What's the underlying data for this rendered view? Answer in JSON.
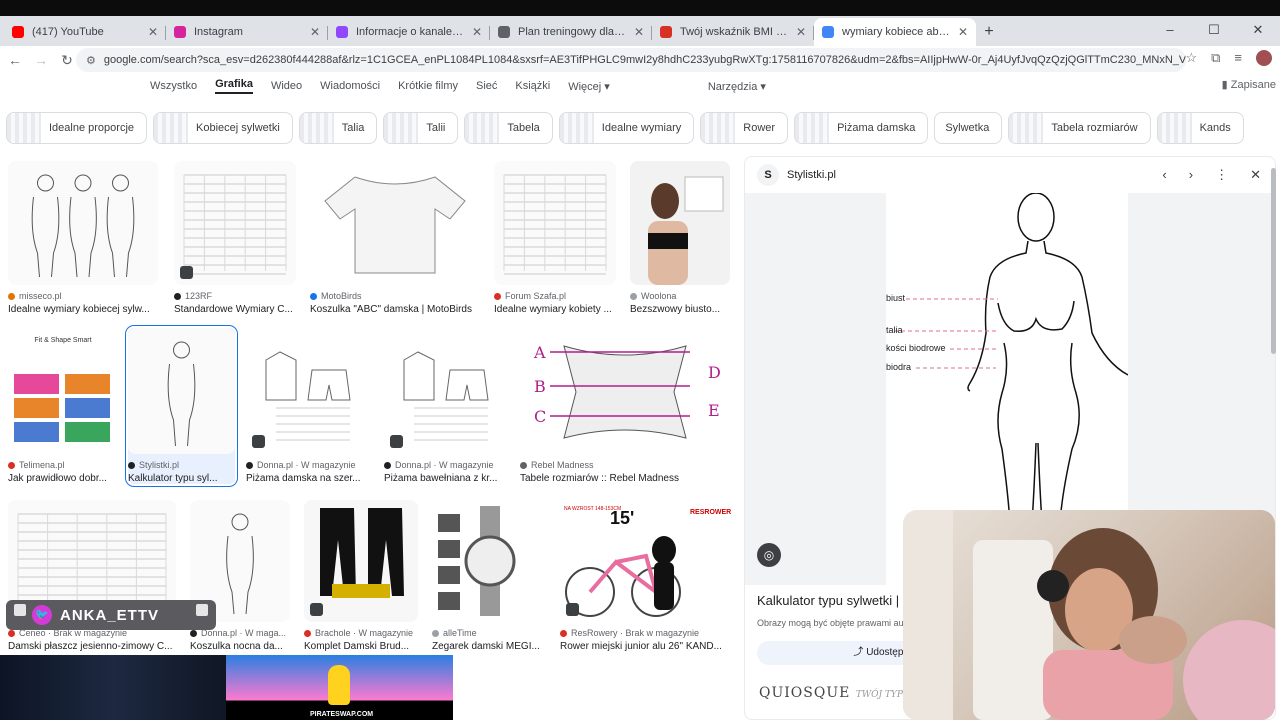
{
  "browser": {
    "tabs": [
      {
        "title": "(417) YouTube",
        "color": "#ff0000",
        "active": false
      },
      {
        "title": "Instagram",
        "color": "#d6249f",
        "active": false
      },
      {
        "title": "Informacje o kanale anka_e - Tw",
        "color": "#9146ff",
        "active": false
      },
      {
        "title": "Plan treningowy dla kobiety",
        "color": "#5f6368",
        "active": false
      },
      {
        "title": "Twój wskaźnik BMI - Diety NFZ",
        "color": "#d93025",
        "active": false
      },
      {
        "title": "wymiary kobiece abc - Szukaj w",
        "color": "#4285f4",
        "active": true
      }
    ],
    "new_tab": "+",
    "url": "google.com/search?sca_esv=d262380f444288af&rlz=1C1GCEA_enPL1084PL1084&sxsrf=AE3TifPHGLC9mwI2y8hdhC233yubgRwXTg:1758116707826&udm=2&fbs=AIIjpHwW-0r_Aj4UyfJvqQzQzjQGlTTmC230_MNxN_VvYo5ocBioNjs2eU9dWE6kP5lXYjf..."
  },
  "search_nav": {
    "tabs": [
      "Wszystko",
      "Grafika",
      "Wideo",
      "Wiadomości",
      "Krótkie filmy",
      "Sieć",
      "Książki",
      "Więcej ▾"
    ],
    "active": "Grafika",
    "tools": "Narzędzia ▾",
    "saved": "Zapisane"
  },
  "chips": [
    "Idealne proporcje",
    "Kobiecej sylwetki",
    "Talia",
    "Talii",
    "Tabela",
    "Idealne wymiary",
    "Rower",
    "Piżama damska",
    "Sylwetka",
    "Tabela rozmiarów",
    "Kands"
  ],
  "results": [
    {
      "source": "misseco.pl",
      "title": "Idealne wymiary kobiecej sylw...",
      "color": "#e37400"
    },
    {
      "source": "123RF",
      "title": "Standardowe Wymiary C...",
      "color": "#202124"
    },
    {
      "source": "MotoBirds",
      "title": "Koszulka \"ABC\" damska | MotoBirds",
      "color": "#1a73e8"
    },
    {
      "source": "Forum Szafa.pl",
      "title": "Idealne wymiary kobiety ...",
      "color": "#d93025"
    },
    {
      "source": "Woolona",
      "title": "Bezszwowy biusto...",
      "color": "#9aa0a6"
    },
    {
      "source": "Telimena.pl",
      "title": "Jak prawidłowo dobr...",
      "color": "#d93025"
    },
    {
      "source": "Stylistki.pl",
      "title": "Kalkulator typu syl...",
      "color": "#202124"
    },
    {
      "source": "Donna.pl · W magazynie",
      "title": "Piżama damska na szer...",
      "color": "#202124"
    },
    {
      "source": "Donna.pl · W magazynie",
      "title": "Piżama bawełniana z kr...",
      "color": "#202124"
    },
    {
      "source": "Rebel Madness",
      "title": "Tabele rozmiarów :: Rebel Madness",
      "color": "#5f6368"
    },
    {
      "source": "Ceneo · Brak w magazynie",
      "title": "Damski płaszcz jesienno-zimowy C...",
      "color": "#d93025"
    },
    {
      "source": "Donna.pl · W maga...",
      "title": "Koszulka nocna da...",
      "color": "#202124"
    },
    {
      "source": "Brachole · W magazynie",
      "title": "Komplet Damski Brud...",
      "color": "#d93025"
    },
    {
      "source": "alleTime",
      "title": "Zegarek damski MEGI...",
      "color": "#9aa0a6"
    },
    {
      "source": "ResRowery · Brak w magazynie",
      "title": "Rower miejski junior alu 26\" KAND...",
      "color": "#d93025"
    }
  ],
  "thumbnail_text": {
    "dim_a": "A",
    "dim_b": "B",
    "dim_c": "C",
    "dim_d": "D",
    "dim_e": "E",
    "fit_title": "Fit & Shape Smart",
    "bike_size": "15'",
    "bike_brand": "RESROWER",
    "bike_note": "NA WZROST 148-153CM"
  },
  "panel": {
    "source_letter": "S",
    "source": "Stylistki.pl",
    "labels": [
      "biust",
      "talia",
      "kości biodrowe",
      "biodra"
    ],
    "title": "Kalkulator typu sylwetki | St",
    "note": "Obrazy mogą być objęte prawami autors",
    "share": "Udostępn",
    "brand": "QUIOSQUE",
    "brand_sub": "TWÓJ TYP SYLW"
  },
  "overlay": {
    "twitter_name": "ANKA_ETTV",
    "banner_text": "PIRATESWAP.COM"
  }
}
